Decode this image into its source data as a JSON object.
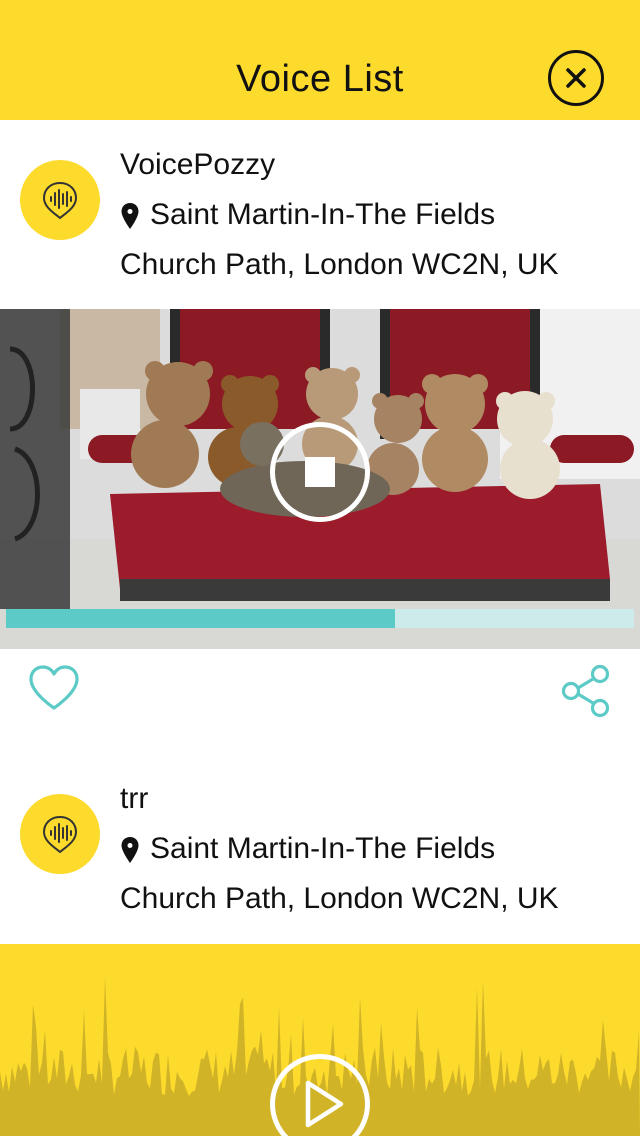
{
  "header": {
    "title": "Voice List"
  },
  "voices": [
    {
      "name": "VoicePozzy",
      "location_line1": "Saint Martin-In-The Fields",
      "location_line2": "Church Path, London WC2N, UK",
      "playback_progress": 0.62,
      "playing": true
    },
    {
      "name": "trr",
      "location_line1": "Saint Martin-In-The Fields",
      "location_line2": "Church Path, London WC2N, UK"
    }
  ],
  "icons": {
    "close": "close-icon",
    "avatar": "voice-wave-icon",
    "pin": "location-pin-icon",
    "stop": "stop-icon",
    "like": "heart-icon",
    "share": "share-icon",
    "play": "play-icon"
  },
  "colors": {
    "brand_yellow": "#fddb2c",
    "accent_teal": "#5ccac6",
    "track_light": "#cdebea",
    "text": "#111111"
  }
}
